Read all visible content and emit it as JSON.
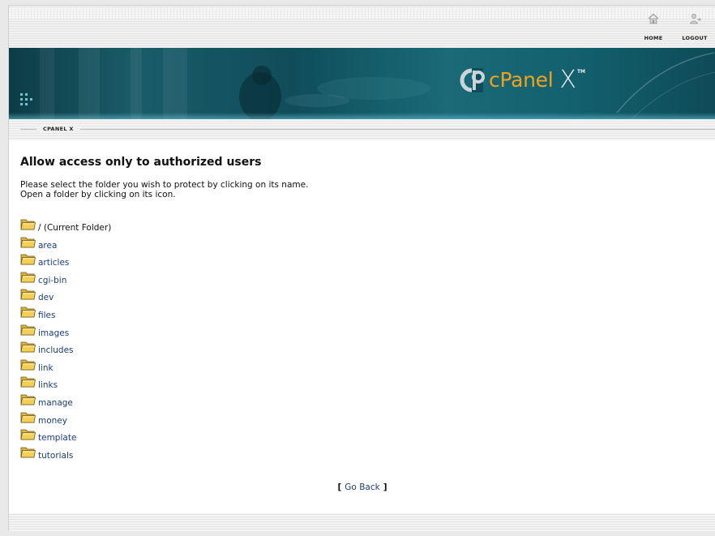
{
  "header": {
    "home_label": "HOME",
    "logout_label": "LOGOUT",
    "home_icon": "home-icon",
    "logout_icon": "logout-icon"
  },
  "banner": {
    "brand": "cPanel",
    "brand_suffix": "X",
    "trademark": "TM",
    "brand_color": "#f2a21b",
    "banner_color": "#0f4d5a"
  },
  "breadcrumb": {
    "label": "CPANEL X"
  },
  "main": {
    "title": "Allow access only to authorized users",
    "instruction_line1": "Please select the folder you wish to protect by clicking on its name.",
    "instruction_line2": "Open a folder by clicking on its icon."
  },
  "folders": [
    {
      "name": "/ (Current Folder)",
      "icon": "folder-icon"
    },
    {
      "name": "area",
      "icon": "folder-icon"
    },
    {
      "name": "articles",
      "icon": "folder-icon"
    },
    {
      "name": "cgi-bin",
      "icon": "folder-icon"
    },
    {
      "name": "dev",
      "icon": "folder-icon"
    },
    {
      "name": "files",
      "icon": "folder-icon"
    },
    {
      "name": "images",
      "icon": "folder-icon"
    },
    {
      "name": "includes",
      "icon": "folder-icon"
    },
    {
      "name": "link",
      "icon": "folder-icon"
    },
    {
      "name": "links",
      "icon": "folder-icon"
    },
    {
      "name": "manage",
      "icon": "folder-icon"
    },
    {
      "name": "money",
      "icon": "folder-icon"
    },
    {
      "name": "template",
      "icon": "folder-icon"
    },
    {
      "name": "tutorials",
      "icon": "folder-icon"
    }
  ],
  "footer": {
    "go_back_label": "Go Back",
    "bracket_open": "[",
    "bracket_close": "]"
  },
  "colors": {
    "link": "#1c3c78",
    "folder_fill": "#f3cf56"
  }
}
